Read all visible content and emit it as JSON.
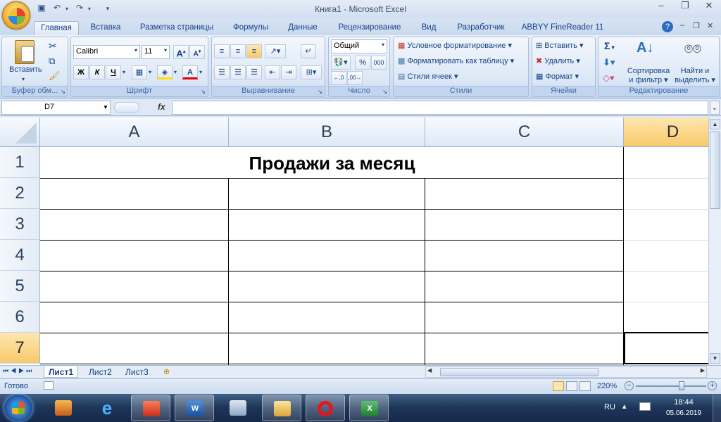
{
  "window": {
    "title": "Книга1 - Microsoft Excel"
  },
  "tabs": [
    "Главная",
    "Вставка",
    "Разметка страницы",
    "Формулы",
    "Данные",
    "Рецензирование",
    "Вид",
    "Разработчик",
    "ABBYY FineReader 11"
  ],
  "ribbon": {
    "clipboard": {
      "paste": "Вставить",
      "label": "Буфер обм..."
    },
    "font": {
      "name": "Calibri",
      "size": "11",
      "bold": "Ж",
      "italic": "К",
      "underline": "Ч",
      "grow": "A",
      "shrink": "A",
      "color_a": "A",
      "label": "Шрифт"
    },
    "alignment": {
      "label": "Выравнивание"
    },
    "number": {
      "format": "Общий",
      "percent": "%",
      "thousands": "000",
      "inc_dec": ",0 ,00",
      "label": "Число"
    },
    "styles": {
      "conditional": "Условное форматирование",
      "table": "Форматировать как таблицу",
      "cell_styles": "Стили ячеек",
      "label": "Стили"
    },
    "cells": {
      "insert": "Вставить",
      "delete": "Удалить",
      "format": "Формат",
      "label": "Ячейки"
    },
    "editing": {
      "sigma": "Σ",
      "sort": "Сортировка",
      "sort2": "и фильтр",
      "find": "Найти и",
      "find2": "выделить",
      "label": "Редактирование"
    }
  },
  "formula_bar": {
    "name_box": "D7",
    "fx": "fx",
    "value": ""
  },
  "grid": {
    "columns": [
      "A",
      "B",
      "C",
      "D"
    ],
    "rows": [
      "1",
      "2",
      "3",
      "4",
      "5",
      "6",
      "7"
    ],
    "title_cell": "Продажи за месяц",
    "selected": "D7"
  },
  "sheets": [
    "Лист1",
    "Лист2",
    "Лист3"
  ],
  "status": {
    "ready": "Готово",
    "zoom": "220%"
  },
  "taskbar": {
    "lang": "RU",
    "time": "18:44",
    "date": "05.06.2019"
  },
  "colors": {
    "accent": "#15428b",
    "selection": "#f8c96a"
  }
}
